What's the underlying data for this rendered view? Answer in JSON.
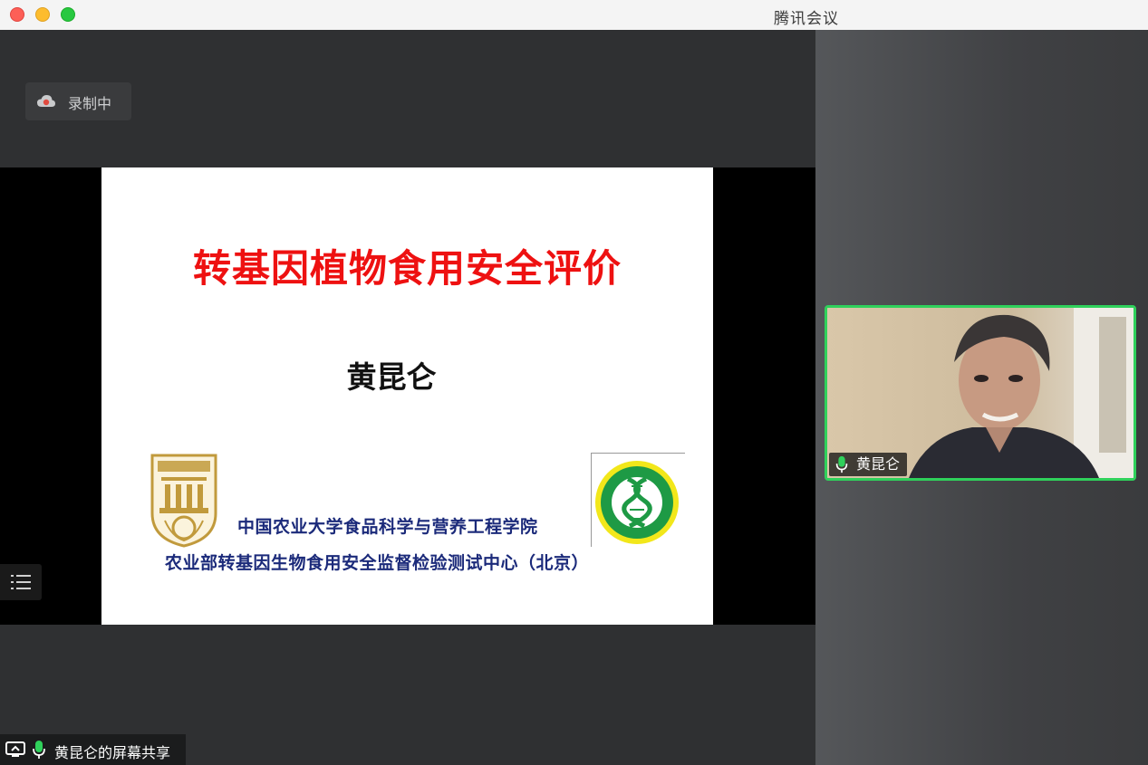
{
  "window": {
    "title": "腾讯会议"
  },
  "recording": {
    "label": "录制中"
  },
  "slide": {
    "title": "转基因植物食用安全评价",
    "author": "黄昆仑",
    "org_line1": "中国农业大学食品科学与营养工程学院",
    "org_line2": "农业部转基因生物食用安全监督检验测试中心（北京）"
  },
  "share_label": {
    "text": "黄昆仑的屏幕共享"
  },
  "participant": {
    "name": "黄昆仑"
  },
  "colors": {
    "accent_green": "#2fd15b",
    "slide_title": "#ee1111",
    "slide_org": "#1b2a7a"
  }
}
